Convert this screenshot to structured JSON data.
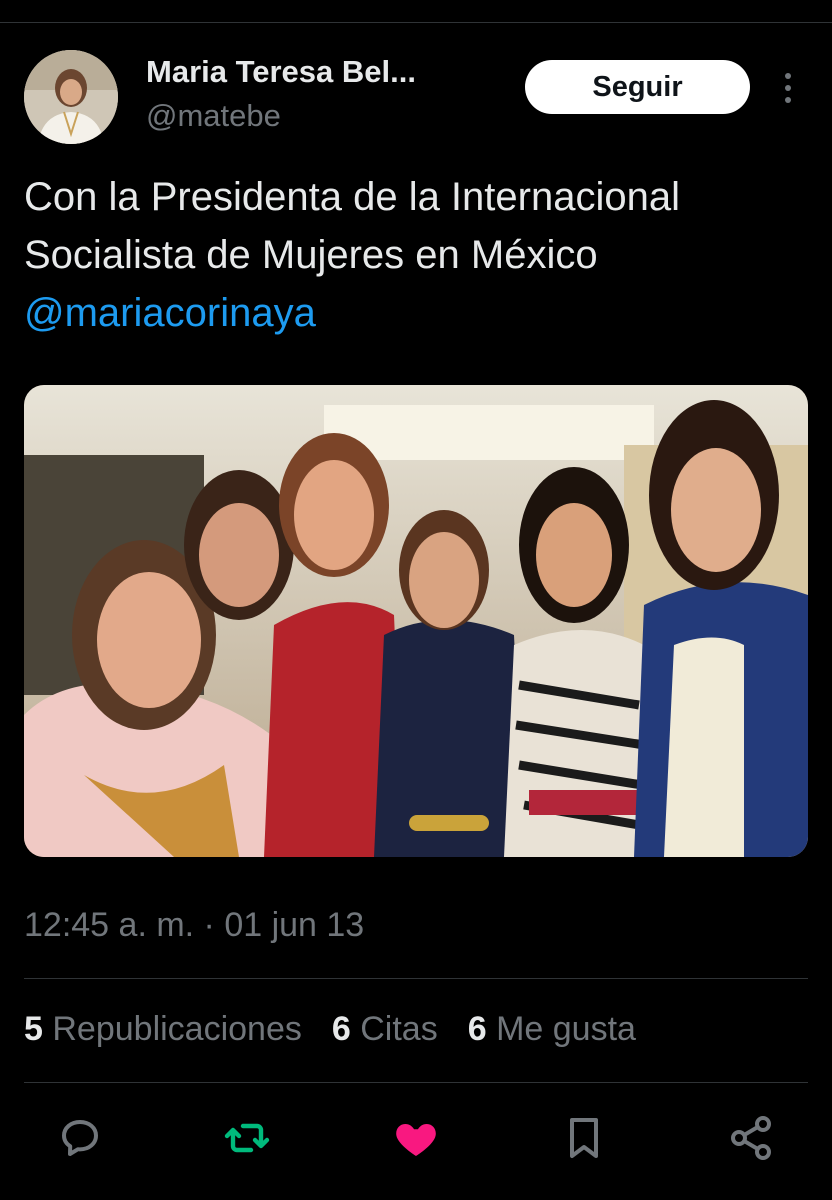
{
  "author": {
    "display_name": "Maria Teresa Bel...",
    "handle": "@matebe",
    "follow_label": "Seguir"
  },
  "tweet": {
    "text_lines": [
      "Con la Presidenta de la Internacional",
      "Socialista de Mujeres en México"
    ],
    "mention": "@mariacorinaya",
    "timestamp": "12:45 a. m. · 01 jun 13"
  },
  "stats": {
    "reposts_count": "5",
    "reposts_label": "Republicaciones",
    "quotes_count": "6",
    "quotes_label": "Citas",
    "likes_count": "6",
    "likes_label": "Me gusta"
  },
  "actions": [
    {
      "icon": "reply-icon"
    },
    {
      "icon": "repost-icon",
      "color": "#00ba7c"
    },
    {
      "icon": "like-icon",
      "color": "#f91880"
    },
    {
      "icon": "bookmark-icon"
    },
    {
      "icon": "share-icon"
    }
  ],
  "colors": {
    "background": "#000000",
    "text": "#e7e9ea",
    "muted": "#71767b",
    "link": "#1d9bf0",
    "repost_active": "#00ba7c",
    "like_active": "#f91880"
  }
}
